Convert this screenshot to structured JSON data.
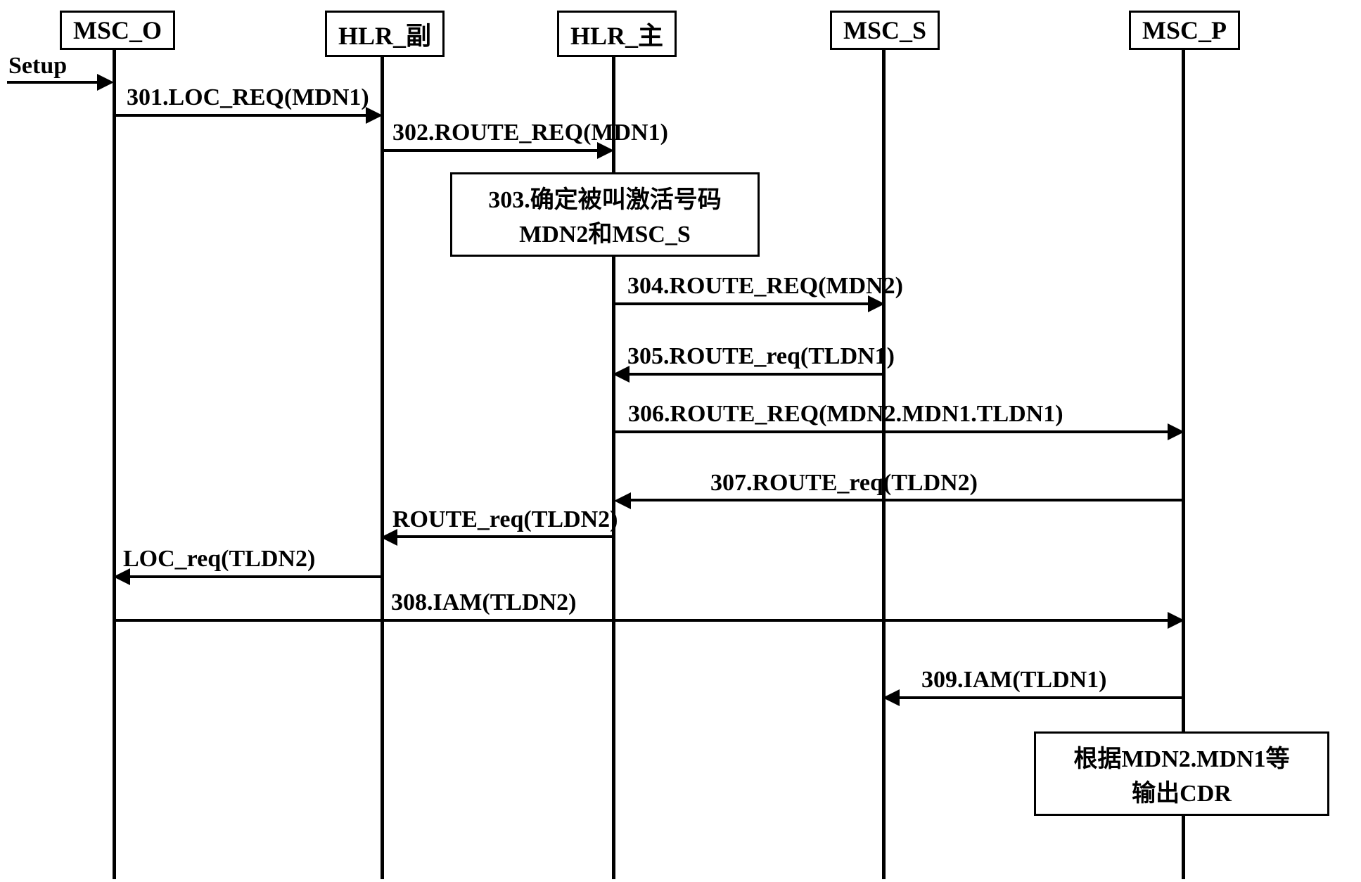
{
  "participants": {
    "p1": "MSC_O",
    "p2": "HLR_副",
    "p3": "HLR_主",
    "p4": "MSC_S",
    "p5": "MSC_P"
  },
  "setup_label": "Setup",
  "messages": {
    "m301": "301.LOC_REQ(MDN1)",
    "m302": "302.ROUTE_REQ(MDN1)",
    "m304": "304.ROUTE_REQ(MDN2)",
    "m305": "305.ROUTE_req(TLDN1)",
    "m306": "306.ROUTE_REQ(MDN2.MDN1.TLDN1)",
    "m307": "307.ROUTE_req(TLDN2)",
    "m_route_req2": "ROUTE_req(TLDN2)",
    "m_loc_req2": "LOC_req(TLDN2)",
    "m308": "308.IAM(TLDN2)",
    "m309": "309.IAM(TLDN1)"
  },
  "notes": {
    "n303_line1": "303.确定被叫激活号码",
    "n303_line2": "MDN2和MSC_S",
    "n_cdr_line1": "根据MDN2.MDN1等",
    "n_cdr_line2": "输出CDR"
  },
  "chart_data": {
    "type": "sequence_diagram",
    "participants": [
      "MSC_O",
      "HLR_副",
      "HLR_主",
      "MSC_S",
      "MSC_P"
    ],
    "interactions": [
      {
        "from": "external",
        "to": "MSC_O",
        "label": "Setup"
      },
      {
        "from": "MSC_O",
        "to": "HLR_副",
        "label": "301.LOC_REQ(MDN1)"
      },
      {
        "from": "HLR_副",
        "to": "HLR_主",
        "label": "302.ROUTE_REQ(MDN1)"
      },
      {
        "type": "note",
        "over": "HLR_主",
        "text": "303.确定被叫激活号码 MDN2和MSC_S"
      },
      {
        "from": "HLR_主",
        "to": "MSC_S",
        "label": "304.ROUTE_REQ(MDN2)"
      },
      {
        "from": "MSC_S",
        "to": "HLR_主",
        "label": "305.ROUTE_req(TLDN1)"
      },
      {
        "from": "HLR_主",
        "to": "MSC_P",
        "label": "306.ROUTE_REQ(MDN2.MDN1.TLDN1)"
      },
      {
        "from": "MSC_P",
        "to": "HLR_主",
        "label": "307.ROUTE_req(TLDN2)"
      },
      {
        "from": "HLR_主",
        "to": "HLR_副",
        "label": "ROUTE_req(TLDN2)"
      },
      {
        "from": "HLR_副",
        "to": "MSC_O",
        "label": "LOC_req(TLDN2)"
      },
      {
        "from": "MSC_O",
        "to": "MSC_P",
        "label": "308.IAM(TLDN2)"
      },
      {
        "from": "MSC_P",
        "to": "MSC_S",
        "label": "309.IAM(TLDN1)"
      },
      {
        "type": "note",
        "over": "MSC_P",
        "text": "根据MDN2.MDN1等 输出CDR"
      }
    ]
  }
}
